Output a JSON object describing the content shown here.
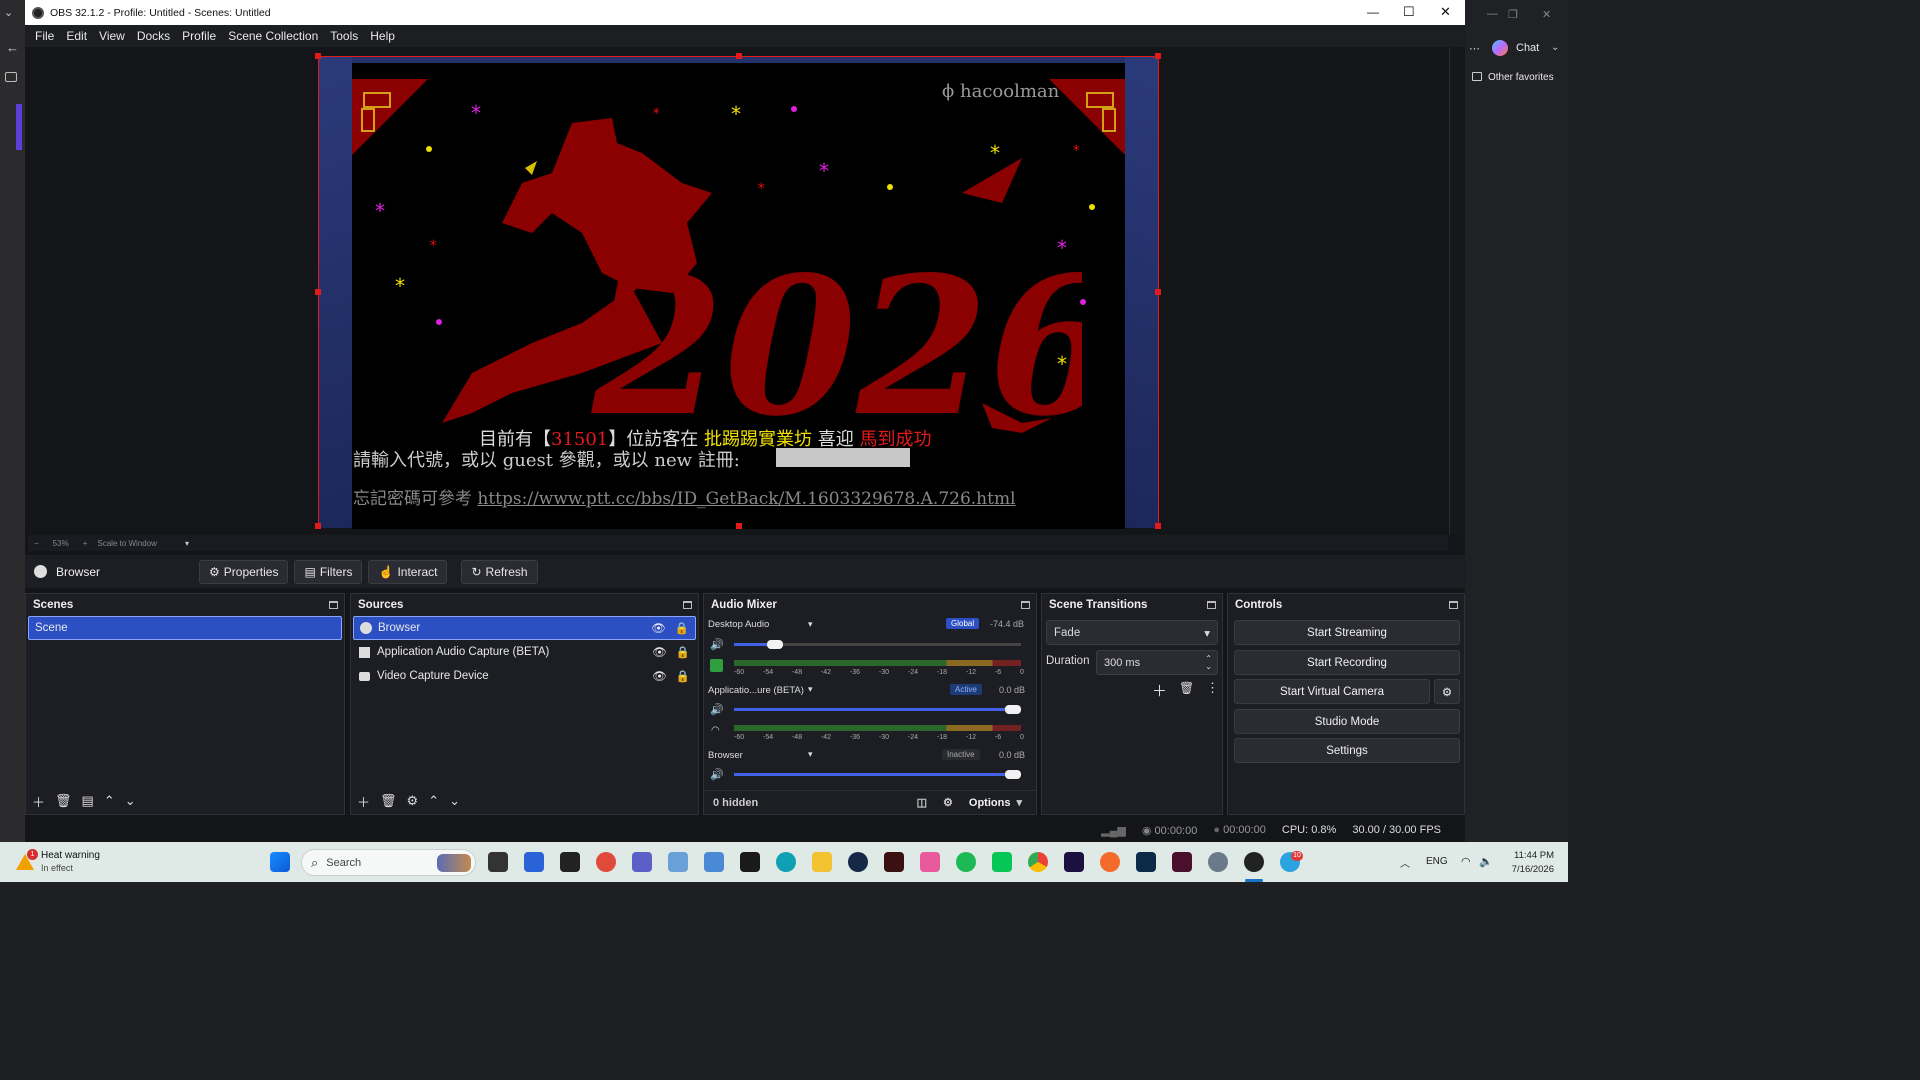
{
  "window": {
    "title": "OBS 32.1.2 - Profile: Untitled - Scenes: Untitled",
    "minimize": "—",
    "maximize": "☐",
    "close": "✕"
  },
  "menu": [
    "File",
    "Edit",
    "View",
    "Docks",
    "Profile",
    "Scene Collection",
    "Tools",
    "Help"
  ],
  "browser_behind": {
    "chat_label": "Chat",
    "favorites_label": "Other favorites"
  },
  "preview": {
    "watermark": "hacoolman",
    "year_art": "2026",
    "visitor_line": {
      "prefix": "目前有【",
      "count": "31501",
      "mid": "】位訪客在",
      "site": "批踢踢實業坊",
      "greet": "喜迎",
      "slogan": "馬到成功"
    },
    "login_prompt": "請輸入代號，或以 guest 參觀，或以 new 註冊:",
    "forgot_prefix": "忘記密碼可參考",
    "forgot_url": "https://www.ptt.cc/bbs/ID_GetBack/M.1603329678.A.726.html"
  },
  "zoom": {
    "minus": "−",
    "value": "53%",
    "plus": "+",
    "mode": "Scale to Window"
  },
  "source_toolbar": {
    "source_name": "Browser",
    "properties": "Properties",
    "filters": "Filters",
    "interact": "Interact",
    "refresh": "Refresh"
  },
  "scenes": {
    "title": "Scenes",
    "items": [
      "Scene"
    ]
  },
  "sources": {
    "title": "Sources",
    "items": [
      "Browser",
      "Application Audio Capture (BETA)",
      "Video Capture Device"
    ]
  },
  "audio_mixer": {
    "title": "Audio Mixer",
    "scale": [
      "-60",
      "-54",
      "-48",
      "-42",
      "-36",
      "-30",
      "-24",
      "-18",
      "-12",
      "-6",
      "0"
    ],
    "channels": [
      {
        "name": "Desktop Audio",
        "badge": "Global",
        "db": "-74.4 dB",
        "volume": 0.12
      },
      {
        "name": "Applicatio...ure (BETA)",
        "badge": "Active",
        "db": "0.0 dB",
        "volume": 1.0
      },
      {
        "name": "Browser",
        "badge": "Inactive",
        "db": "0.0 dB",
        "volume": 1.0
      }
    ],
    "hidden": "0 hidden",
    "options": "Options"
  },
  "transitions": {
    "title": "Scene Transitions",
    "selected": "Fade",
    "duration_label": "Duration",
    "duration_value": "300 ms"
  },
  "controls": {
    "title": "Controls",
    "start_streaming": "Start Streaming",
    "start_recording": "Start Recording",
    "start_virtual_camera": "Start Virtual Camera",
    "studio_mode": "Studio Mode",
    "settings": "Settings"
  },
  "status": {
    "stream_time": "00:00:00",
    "rec_time": "00:00:00",
    "cpu": "CPU: 0.8%",
    "fps": "30.00 / 30.00 FPS"
  },
  "taskbar": {
    "warning_title": "Heat warning",
    "warning_sub": "In effect",
    "warning_count": "1",
    "search": "Search",
    "lang": "ENG",
    "time": "11:44 PM",
    "date": "7/16/2026",
    "notif_count": "10"
  },
  "colors": {
    "accent": "#2c4fc4",
    "selection_border": "#e21a1a",
    "art_red": "#8b0000"
  }
}
